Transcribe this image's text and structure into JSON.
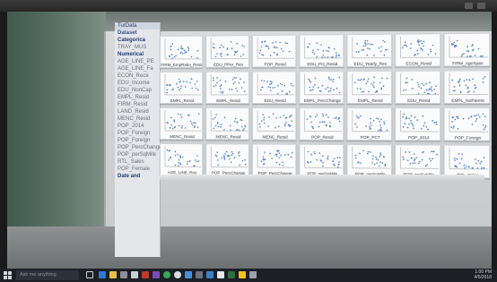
{
  "panel": {
    "header": "TurData",
    "items": [
      {
        "label": "Dataset",
        "style": "head"
      },
      {
        "label": "Categorica",
        "style": "group"
      },
      {
        "label": "TRAY_MUS",
        "style": "item"
      },
      {
        "label": "Numerical",
        "style": "group"
      },
      {
        "label": "AGE_LINE_PE",
        "style": "item"
      },
      {
        "label": "AGE_LINE_Fa",
        "style": "item"
      },
      {
        "label": "ECON_Rece",
        "style": "item"
      },
      {
        "label": "EDU_Income",
        "style": "item"
      },
      {
        "label": "EDU_NonCap",
        "style": "item"
      },
      {
        "label": "EMPL_Resid",
        "style": "item"
      },
      {
        "label": "FIRM_Resid",
        "style": "item"
      },
      {
        "label": "LAND_Resid",
        "style": "item"
      },
      {
        "label": "MENC_Resid",
        "style": "item"
      },
      {
        "label": "POP_2014",
        "style": "item"
      },
      {
        "label": "POP_Foreign",
        "style": "item"
      },
      {
        "label": "POP_Foreign",
        "style": "item"
      },
      {
        "label": "POP_PercChange",
        "style": "item"
      },
      {
        "label": "POP_perSqMile",
        "style": "item"
      },
      {
        "label": "RTL_Sales",
        "style": "item"
      },
      {
        "label": "POP_Female",
        "style": "item"
      },
      {
        "label": "Date and",
        "style": "group"
      }
    ]
  },
  "charts": {
    "color": "#4d7fc0",
    "thumbs": [
      "FIRM_EmpRatio_Resid",
      "EDU_PPer_Res",
      "POP_Resid",
      "EDU_Pct_Resid",
      "EDU_Yearly_Res",
      "ECON_Resid",
      "FIRM_AgeSpan",
      "EMPL_Resid",
      "EMPL_Resid",
      "EDU_Resid",
      "EMPL_PercChange",
      "EMPL_Resid",
      "EDU_Resid",
      "EMPL_NoParent",
      "MENC_Resid",
      "MENC_Resid",
      "MENC_Resid",
      "POP_Resid",
      "POP_PCT",
      "POP_2014",
      "POP_Foreign",
      "AGE_LINE_Res",
      "POP_PercChange",
      "POP_PercChange",
      "POP_perSqMile",
      "POP_perSqMile",
      "POP_perSqMile",
      "RTL_Sales"
    ]
  },
  "taskbar": {
    "search_placeholder": "Ask me anything",
    "time": "1:00 PM",
    "date": "4/5/2018"
  }
}
